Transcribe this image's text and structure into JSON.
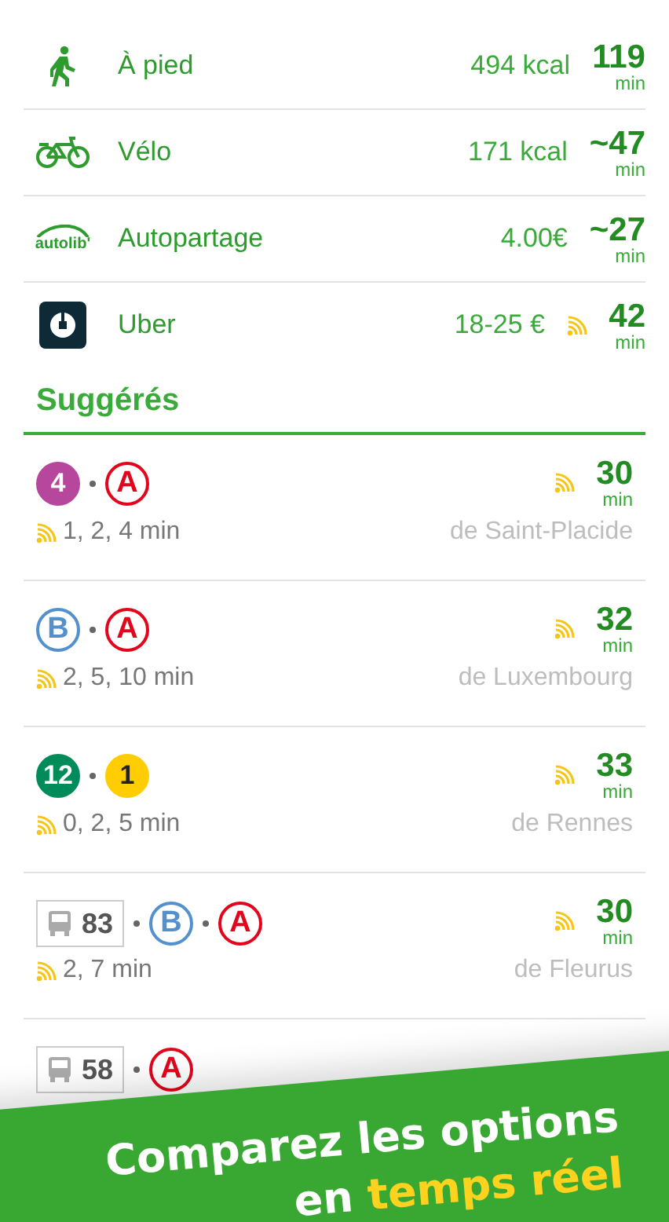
{
  "modes": [
    {
      "kind": "walk",
      "name": "À pied",
      "detail": "494 kcal",
      "duration": "119",
      "unit": "min",
      "realtime": false
    },
    {
      "kind": "bike",
      "name": "Vélo",
      "detail": "171 kcal",
      "duration": "~47",
      "unit": "min",
      "realtime": false
    },
    {
      "kind": "carshare",
      "logo_text": "autolib'",
      "name": "Autopartage",
      "detail": "4.00€",
      "duration": "~27",
      "unit": "min",
      "realtime": false
    },
    {
      "kind": "ride",
      "name": "Uber",
      "detail": "18-25 €",
      "duration": "42",
      "unit": "min",
      "realtime": true
    }
  ],
  "section_title": "Suggérés",
  "routes": [
    {
      "lines": [
        {
          "kind": "filled",
          "label": "4",
          "color": "#b6479c"
        },
        {
          "kind": "outline",
          "label": "A",
          "color": "#e3051c"
        }
      ],
      "realtime": true,
      "duration": "30",
      "unit": "min",
      "departures": "1, 2, 4 min",
      "origin": "de Saint-Placide"
    },
    {
      "lines": [
        {
          "kind": "outline",
          "label": "B",
          "color": "#5291ce"
        },
        {
          "kind": "outline",
          "label": "A",
          "color": "#e3051c"
        }
      ],
      "realtime": true,
      "duration": "32",
      "unit": "min",
      "departures": "2, 5, 10 min",
      "origin": "de Luxembourg"
    },
    {
      "lines": [
        {
          "kind": "filled",
          "label": "12",
          "color": "#008b5b"
        },
        {
          "kind": "filled_dark",
          "label": "1",
          "color": "#ffcd00"
        }
      ],
      "realtime": true,
      "duration": "33",
      "unit": "min",
      "departures": "0, 2, 5 min",
      "origin": "de Rennes"
    },
    {
      "lines": [
        {
          "kind": "bus",
          "label": "83"
        },
        {
          "kind": "outline",
          "label": "B",
          "color": "#5291ce"
        },
        {
          "kind": "outline",
          "label": "A",
          "color": "#e3051c"
        }
      ],
      "realtime": true,
      "duration": "30",
      "unit": "min",
      "departures": "2, 7 min",
      "origin": "de Fleurus"
    },
    {
      "lines": [
        {
          "kind": "bus",
          "label": "58"
        },
        {
          "kind": "outline",
          "label": "A",
          "color": "#e3051c"
        }
      ]
    }
  ],
  "banner": {
    "line_1": "Comparez les options",
    "line_2_start": "en",
    "line_2_highlight": "temps réel"
  }
}
